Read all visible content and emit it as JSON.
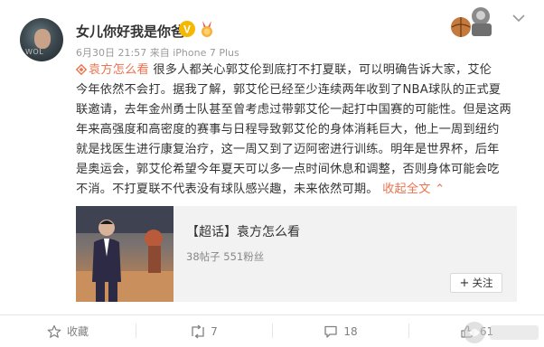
{
  "header": {
    "username": "女儿你好我是你爸",
    "timestamp": "6月30日 21:57",
    "source_prefix": "来自",
    "source": "iPhone 7 Plus",
    "verified_badge": "V",
    "avatar_watermark": "WOL"
  },
  "post": {
    "tag": "袁方怎么看",
    "lines": [
      "很多人都关心郭艾伦到底打不打夏联，可以明确告诉大家，艾伦",
      "今年依然不会打。据我了解，郭艾伦已经至少连续两年收到了NBA球队的正式夏",
      "联邀请，去年金州勇士队甚至曾考虑过带郭艾伦一起打中国赛的可能性。但是这两",
      "年来高强度和高密度的赛事与日程导致郭艾伦的身体消耗巨大，他上一周到纽约",
      "就是找医生进行康复治疗，这一周又到了迈阿密进行训练。明年是世界杯，后年",
      "是奥运会，郭艾伦希望今年夏天可以多一点时间休息和调整，否则身体可能会吃",
      "不消。不打夏联不代表没有球队感兴趣，未来依然可期。"
    ],
    "more_label": "收起全文",
    "more_arrow": "⌃"
  },
  "card": {
    "title": "【超话】袁方怎么看",
    "stats": "38帖子 551粉丝",
    "follow_label": "关注",
    "follow_plus": "+"
  },
  "footer": {
    "favorite_label": "收藏",
    "repost_count": "7",
    "comment_count": "18",
    "like_count": "61"
  },
  "colors": {
    "accent": "#eb7350",
    "text": "#333333",
    "muted": "#9a9a9a",
    "vip_gold": "#f5b800"
  },
  "icons": [
    "avatar",
    "vip-badge-icon",
    "medal-icon",
    "top-badge-image",
    "chevron-down-icon",
    "super-topic-icon",
    "star-icon",
    "repost-icon",
    "comment-icon",
    "like-icon"
  ]
}
